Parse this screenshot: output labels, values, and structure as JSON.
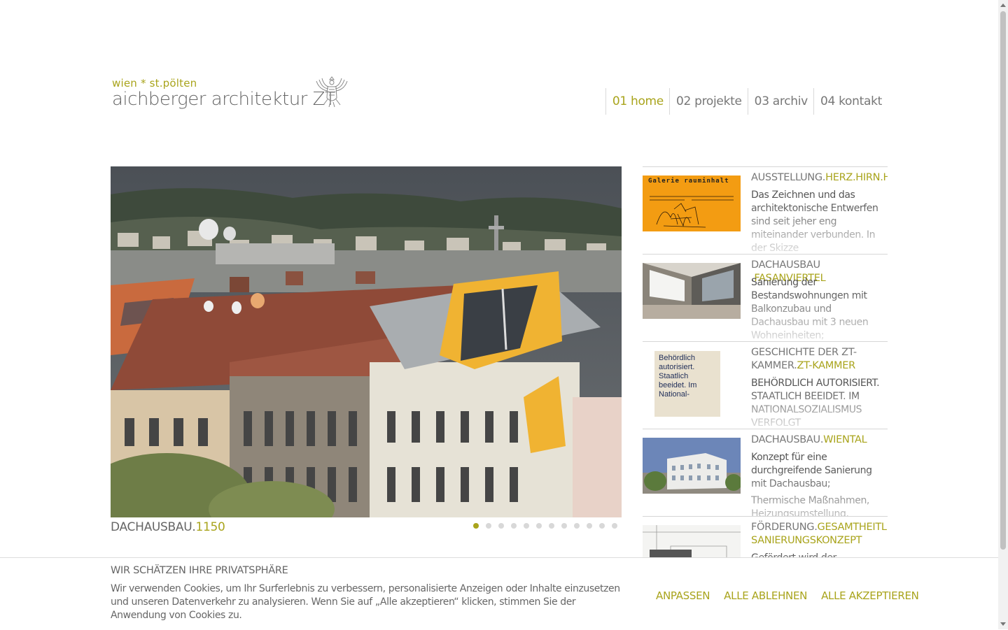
{
  "header": {
    "logo_sub": "wien * st.pölten",
    "logo_main": "aichberger architektur ZT"
  },
  "nav": [
    {
      "label": "01 home",
      "active": true
    },
    {
      "label": "02 projekte",
      "active": false
    },
    {
      "label": "03 archiv",
      "active": false
    },
    {
      "label": "04 kontakt",
      "active": false
    }
  ],
  "slider": {
    "caption_prefix": "DACHAUSBAU.",
    "caption_accent": "1150",
    "slide_count": 12,
    "active_index": 0
  },
  "news": [
    {
      "title_prefix": "AUSSTELLUNG.",
      "title_accent": "HERZ.HIRN.HAND",
      "text": "Das Zeichnen und das architektonische Entwerfen sind seit jeher eng miteinander verbunden. In der Skizze",
      "thumb_text": "Galerie rauminhalt"
    },
    {
      "title_prefix": "DACHAUSBAU .",
      "title_accent": "FASANVIERTEL",
      "text": "Sanierung der Bestandswohnungen mit Balkonzubau und Dachausbau mit 3 neuen Wohneinheiten;"
    },
    {
      "title_prefix": "GESCHICHTE DER ZT-KAMMER.",
      "title_accent": "ZT-KAMMER",
      "text": "BEHÖRDLICH AUTORISIERT. STAATLICH BEEIDET. IM NATIONALSOZIALISMUS VERFOLGT",
      "thumb_text": "Behördlich autorisiert. Staatlich beeidet. Im National-"
    },
    {
      "title_prefix": "DACHAUSBAU.",
      "title_accent": "WIENTAL",
      "text": "Konzept für eine durchgreifende Sanierung mit Dachausbau;",
      "text2": "Thermische Maßnahmen, Heizungsumstellung, Lifteinbau"
    },
    {
      "title_prefix": "FÖRDERUNG.",
      "title_accent": "GESAMTHEITLICHES SANIERUNGSKONZEPT",
      "text": "Gefördert wird der"
    }
  ],
  "cookie": {
    "title": "WIR SCHÄTZEN IHRE PRIVATSPHÄRE",
    "text": "Wir verwenden Cookies, um Ihr Surferlebnis zu verbessern, personalisierte Anzeigen oder Inhalte einzusetzen und unseren Datenverkehr zu analysieren. Wenn Sie auf „Alle akzeptieren“ klicken, stimmen Sie der Anwendung von Cookies zu.",
    "customize": "ANPASSEN",
    "reject": "ALLE ABLEHNEN",
    "accept": "ALLE AKZEPTIEREN"
  },
  "colors": {
    "accent": "#a9a41c",
    "text": "#666666",
    "border": "#d6d6d6"
  }
}
